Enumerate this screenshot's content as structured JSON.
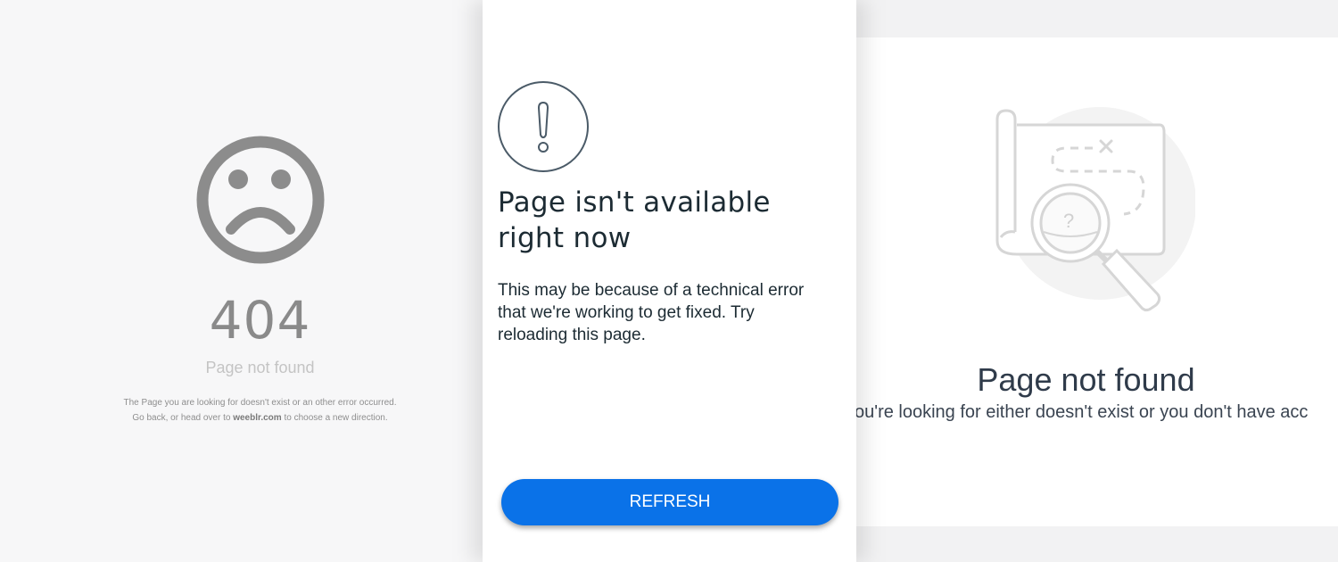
{
  "left_panel": {
    "code": "404",
    "subtitle": "Page not found",
    "desc_line1": "The Page you are looking for doesn't exist or an other error occurred.",
    "desc_line2_pre": "Go back, or head over to ",
    "desc_line2_link": "weeblr.com",
    "desc_line2_post": " to choose a new direction.",
    "icon": "sad-face-icon"
  },
  "middle_panel": {
    "icon": "exclamation-circle-icon",
    "title": "Page isn't available right now",
    "description": "This may be because of a technical error that we're working to get fixed. Try reloading this page.",
    "button_label": "REFRESH",
    "accent_color": "#0a72e8"
  },
  "right_panel": {
    "icon": "map-magnifier-icon",
    "title": "Page not found",
    "description": "ou're looking for either doesn't exist or you don't have acc"
  }
}
